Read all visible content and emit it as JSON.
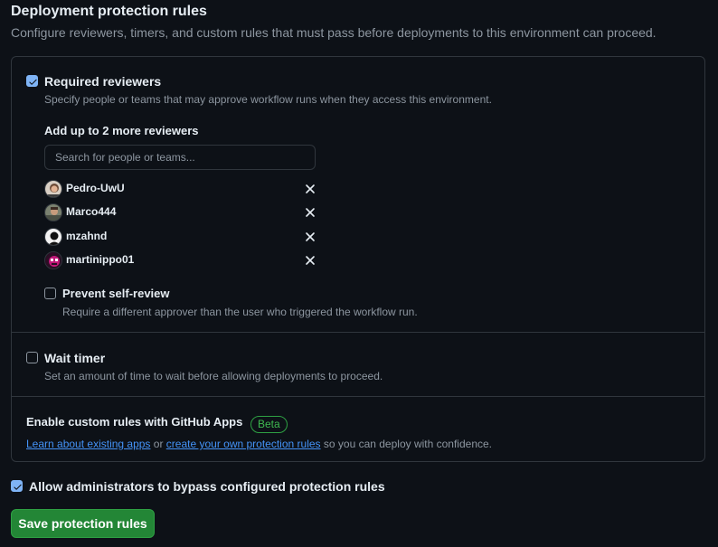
{
  "title": "Deployment protection rules",
  "subtitle": "Configure reviewers, timers, and custom rules that must pass before deployments to this environment can proceed.",
  "required_reviewers": {
    "checked": true,
    "label": "Required reviewers",
    "description": "Specify people or teams that may approve workflow runs when they access this environment.",
    "add_label": "Add up to 2 more reviewers",
    "search_placeholder": "Search for people or teams...",
    "reviewers": [
      {
        "name": "Pedro-UwU",
        "avatar": "avatar-portrait"
      },
      {
        "name": "Marco444",
        "avatar": "avatar-photo"
      },
      {
        "name": "mzahnd",
        "avatar": "avatar-silhouette"
      },
      {
        "name": "martinippo01",
        "avatar": "avatar-pixel-art"
      }
    ],
    "prevent_self_review": {
      "checked": false,
      "label": "Prevent self-review",
      "description": "Require a different approver than the user who triggered the workflow run."
    }
  },
  "wait_timer": {
    "checked": false,
    "label": "Wait timer",
    "description": "Set an amount of time to wait before allowing deployments to proceed."
  },
  "custom_rules": {
    "title": "Enable custom rules with GitHub Apps",
    "badge": "Beta",
    "link1": "Learn about existing apps",
    "text_or": " or ",
    "link2": "create your own protection rules",
    "text_after": " so you can deploy with confidence."
  },
  "allow_admins": {
    "checked": true,
    "label": "Allow administrators to bypass configured protection rules"
  },
  "save_button": "Save protection rules",
  "colors": {
    "background": "#0d1117",
    "border": "#30363d",
    "text": "#e6edf3",
    "muted": "#8d96a0",
    "link": "#4493f8",
    "primary_button": "#238636",
    "badge_green": "#3fb950",
    "checkbox_checked": "#7fb4f6"
  }
}
